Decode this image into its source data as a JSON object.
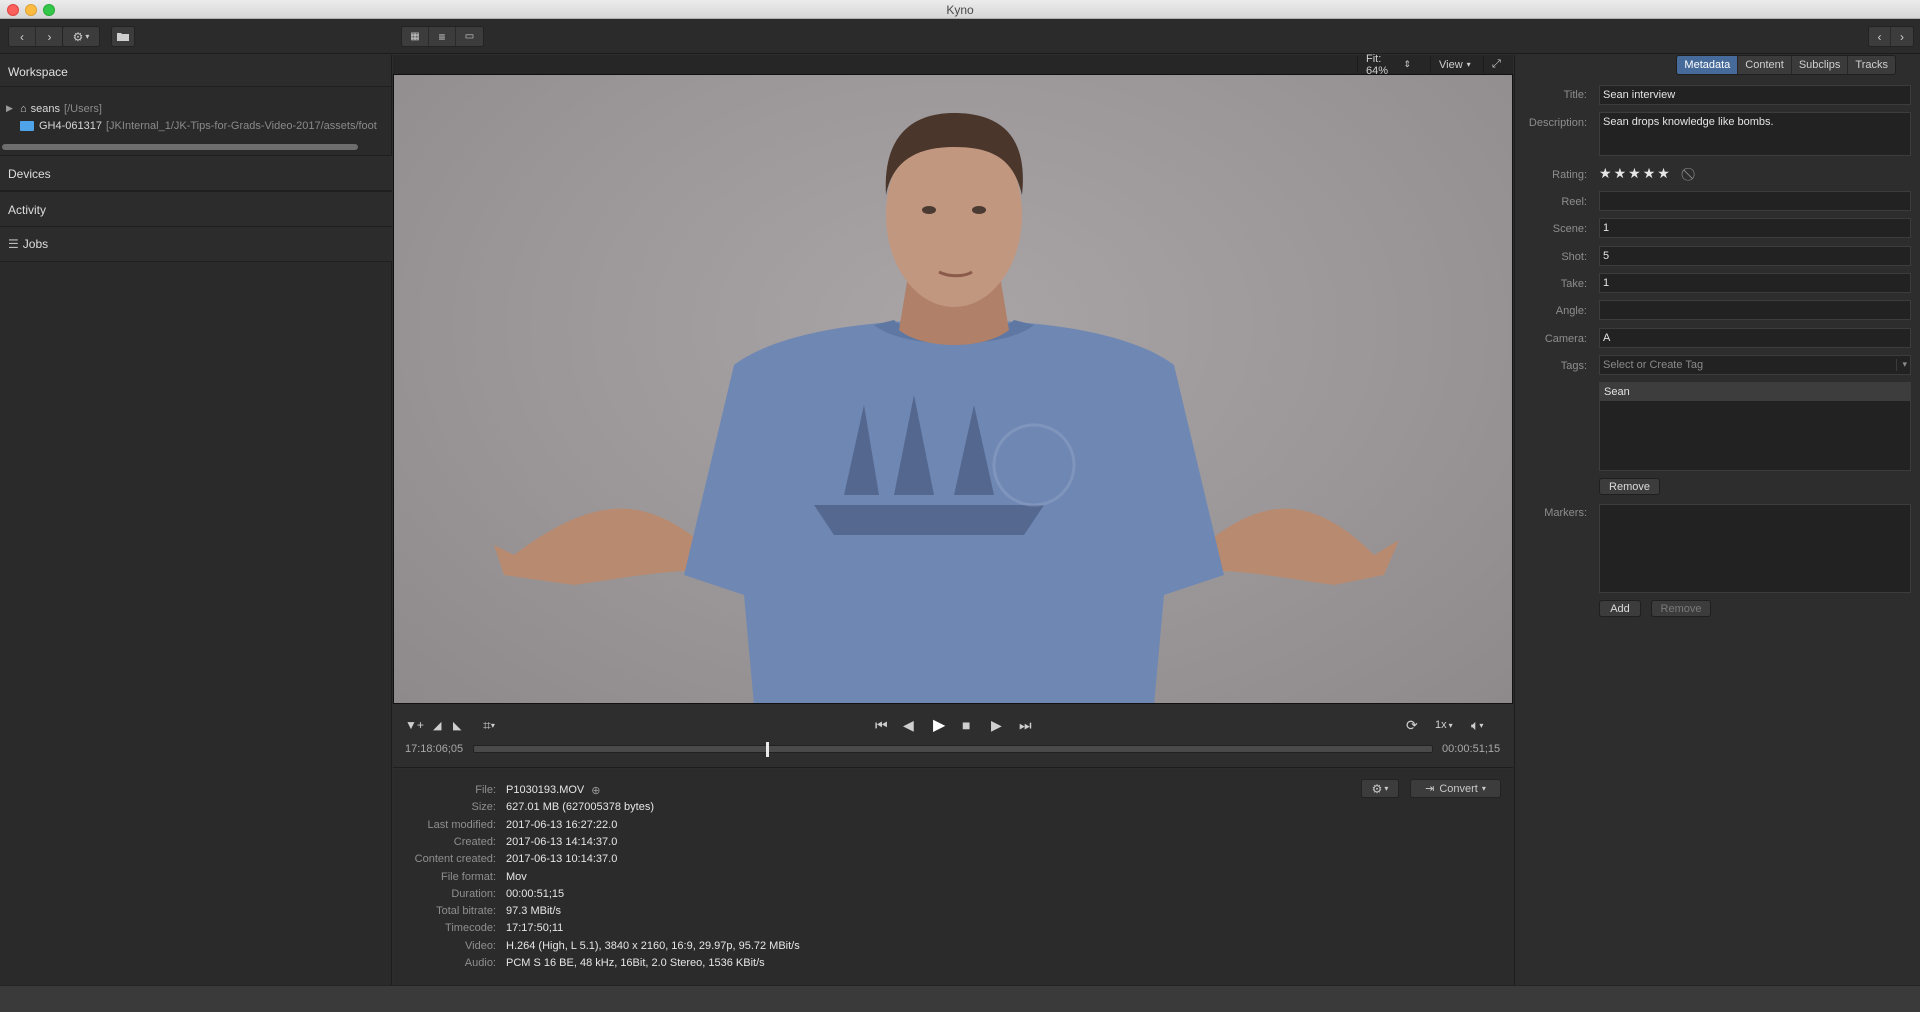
{
  "window": {
    "title": "Kyno"
  },
  "toolbar": {
    "back_icon": "chevron-left-icon",
    "forward_icon": "chevron-right-icon",
    "settings_icon": "gear-icon",
    "folder_icon": "folder-add-icon",
    "view_modes": [
      "grid-view-icon",
      "list-view-icon",
      "single-view-icon"
    ],
    "nav_prev": "chevron-left-icon",
    "nav_next": "chevron-right-icon"
  },
  "sidebar": {
    "workspace_label": "Workspace",
    "tree": [
      {
        "name": "seans",
        "path": "[/Users]"
      },
      {
        "name": "GH4-061317",
        "path": "[JKInternal_1/JK-Tips-for-Grads-Video-2017/assets/foot"
      }
    ],
    "sections": [
      "Devices",
      "Activity",
      "Jobs"
    ]
  },
  "viewer": {
    "fit_label": "Fit: 64%",
    "view_label": "View",
    "timecode_start": "17:18:06;05",
    "timecode_end": "00:00:51;15",
    "playhead_fraction": 0.305,
    "speed_label": "1x"
  },
  "file_info": {
    "convert_label": "Convert",
    "rows": [
      {
        "label": "File:",
        "value": "P1030193.MOV"
      },
      {
        "label": "Size:",
        "value": "627.01 MB (627005378 bytes)"
      },
      {
        "label": "Last modified:",
        "value": "2017-06-13 16:27:22.0"
      },
      {
        "label": "Created:",
        "value": "2017-06-13 14:14:37.0"
      },
      {
        "label": "Content created:",
        "value": "2017-06-13 10:14:37.0"
      },
      {
        "label": "File format:",
        "value": "Mov"
      },
      {
        "label": "Duration:",
        "value": "00:00:51;15"
      },
      {
        "label": "Total bitrate:",
        "value": "97.3 MBit/s"
      },
      {
        "label": "Timecode:",
        "value": "17:17:50;11"
      },
      {
        "label": "Video:",
        "value": "H.264 (High, L 5.1), 3840 x 2160, 16:9, 29.97p, 95.72 MBit/s"
      },
      {
        "label": "Audio:",
        "value": "PCM S 16 BE, 48 kHz, 16Bit, 2.0 Stereo, 1536 KBit/s"
      }
    ]
  },
  "metadata": {
    "tabs": [
      "Metadata",
      "Content",
      "Subclips",
      "Tracks"
    ],
    "title_label": "Title:",
    "title_value": "Sean interview",
    "description_label": "Description:",
    "description_value": "Sean drops knowledge like bombs.",
    "rating_label": "Rating:",
    "rating_value": 5,
    "reel_label": "Reel:",
    "reel_value": "",
    "scene_label": "Scene:",
    "scene_value": "1",
    "shot_label": "Shot:",
    "shot_value": "5",
    "take_label": "Take:",
    "take_value": "1",
    "angle_label": "Angle:",
    "angle_value": "",
    "camera_label": "Camera:",
    "camera_value": "A",
    "tags_label": "Tags:",
    "tags_placeholder": "Select or Create Tag",
    "tags": [
      "Sean"
    ],
    "remove_tag_label": "Remove",
    "markers_label": "Markers:",
    "add_marker_label": "Add",
    "remove_marker_label": "Remove"
  }
}
